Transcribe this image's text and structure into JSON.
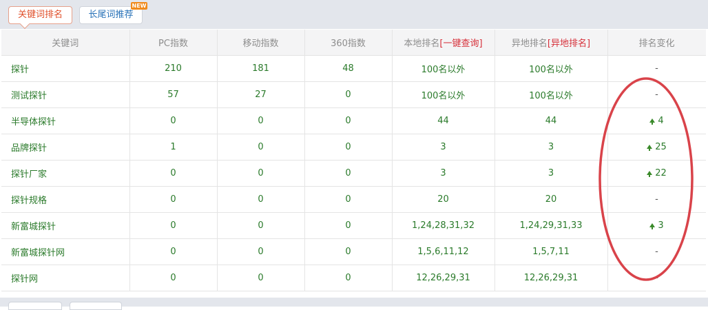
{
  "tabs": {
    "active_label": "关键词排名",
    "second_label": "长尾词推荐",
    "new_badge": "NEW"
  },
  "table": {
    "headers": {
      "keyword": "关键词",
      "pc": "PC指数",
      "mobile": "移动指数",
      "index360": "360指数",
      "local_rank": "本地排名",
      "local_rank_link": "[一键查询]",
      "remote_rank": "异地排名",
      "remote_rank_link": "[异地排名]",
      "rank_change": "排名变化"
    },
    "rows": [
      {
        "keyword": "探针",
        "pc": "210",
        "mobile": "181",
        "i360": "48",
        "local": "100名以外",
        "remote": "100名以外",
        "change": "-",
        "up": false
      },
      {
        "keyword": "测试探针",
        "pc": "57",
        "mobile": "27",
        "i360": "0",
        "local": "100名以外",
        "remote": "100名以外",
        "change": "-",
        "up": false
      },
      {
        "keyword": "半导体探针",
        "pc": "0",
        "mobile": "0",
        "i360": "0",
        "local": "44",
        "remote": "44",
        "change": "4",
        "up": true
      },
      {
        "keyword": "品牌探针",
        "pc": "1",
        "mobile": "0",
        "i360": "0",
        "local": "3",
        "remote": "3",
        "change": "25",
        "up": true
      },
      {
        "keyword": "探针厂家",
        "pc": "0",
        "mobile": "0",
        "i360": "0",
        "local": "3",
        "remote": "3",
        "change": "22",
        "up": true
      },
      {
        "keyword": "探针规格",
        "pc": "0",
        "mobile": "0",
        "i360": "0",
        "local": "20",
        "remote": "20",
        "change": "-",
        "up": false
      },
      {
        "keyword": "新富城探针",
        "pc": "0",
        "mobile": "0",
        "i360": "0",
        "local": "1,24,28,31,32",
        "remote": "1,24,29,31,33",
        "change": "3",
        "up": true
      },
      {
        "keyword": "新富城探针网",
        "pc": "0",
        "mobile": "0",
        "i360": "0",
        "local": "1,5,6,11,12",
        "remote": "1,5,7,11",
        "change": "-",
        "up": false
      },
      {
        "keyword": "探针网",
        "pc": "0",
        "mobile": "0",
        "i360": "0",
        "local": "12,26,29,31",
        "remote": "12,26,29,31",
        "change": "-",
        "up": false
      }
    ]
  },
  "colors": {
    "text_green": "#2a7a2a",
    "accent_orange": "#e0502b",
    "link_red": "#d6303a",
    "annotation_red": "#d9434a"
  }
}
